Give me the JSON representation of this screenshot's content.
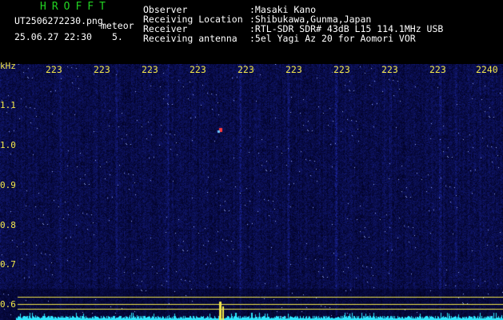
{
  "header": {
    "logo": "HROFFT",
    "file_name": "UT2506272230.png",
    "meteor_label": "meteor",
    "timestamp": "25.06.27 22:30",
    "meteor_count": "5.",
    "info": [
      {
        "label": "Observer",
        "value": ":Masaki Kano"
      },
      {
        "label": "Receiving Location",
        "value": ":Shibukawa,Gunma,Japan"
      },
      {
        "label": "Receiver",
        "value": ":RTL-SDR SDR# 43dB L15 114.1MHz USB"
      },
      {
        "label": "Receiving antenna",
        "value": ":5el Yagi Az 20 for Aomori VOR"
      }
    ]
  },
  "spectrogram": {
    "y_unit": "kHz",
    "time_ticks": [
      "223",
      "223",
      "223",
      "223",
      "223",
      "223",
      "223",
      "223",
      "223",
      "2240"
    ],
    "freq_ticks": [
      "1.1",
      "1.0",
      "0.9",
      "0.8",
      "0.7",
      "0.6"
    ],
    "colors": {
      "background": "#000000",
      "noise": "#0f1a6e",
      "signal": "#2ee6ff",
      "guide": "#f4e84a",
      "text": "#ffffff",
      "logo": "#22d422"
    }
  }
}
